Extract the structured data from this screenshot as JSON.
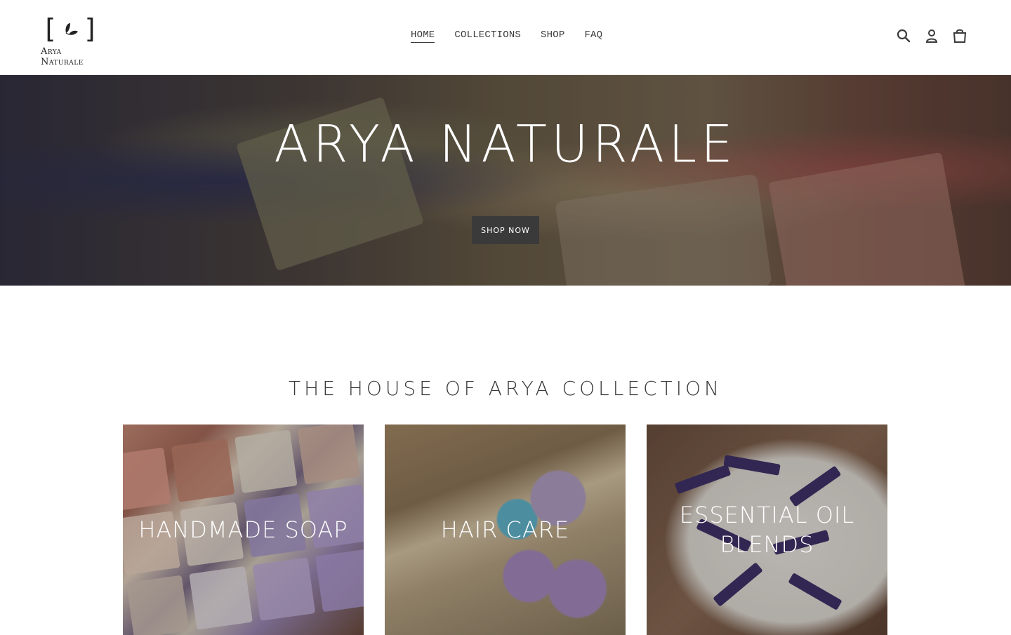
{
  "brand": {
    "logo_text": "Arya Naturale"
  },
  "nav": {
    "items": [
      {
        "label": "HOME",
        "active": true
      },
      {
        "label": "COLLECTIONS",
        "active": false
      },
      {
        "label": "SHOP",
        "active": false
      },
      {
        "label": "FAQ",
        "active": false
      }
    ]
  },
  "header_icons": [
    "search-icon",
    "account-icon",
    "cart-icon"
  ],
  "hero": {
    "title": "ARYA NATURALE",
    "button_label": "SHOP NOW"
  },
  "collection": {
    "title": "THE HOUSE OF ARYA COLLECTION",
    "cards": [
      {
        "label": "HANDMADE SOAP"
      },
      {
        "label": "HAIR CARE"
      },
      {
        "label": "ESSENTIAL OIL BLENDS"
      }
    ]
  },
  "colors": {
    "text": "#3a3a3a",
    "button_bg": "#3a3a3a",
    "background": "#ffffff"
  }
}
